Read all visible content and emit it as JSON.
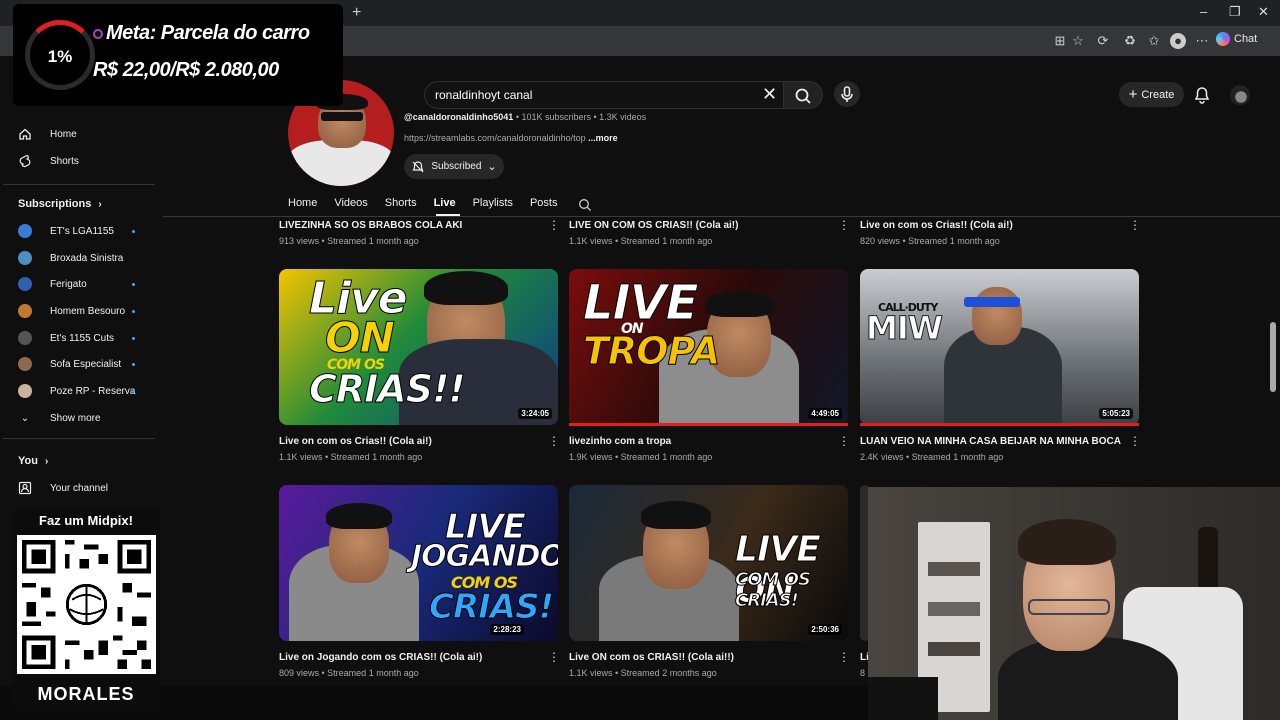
{
  "browser": {
    "new_tab": "+",
    "chat_label": "Chat",
    "window_controls": [
      "–",
      "❐",
      "✕"
    ]
  },
  "header": {
    "search_value": "ronaldinhoyt canal",
    "create_label": "Create"
  },
  "sidebar": {
    "home": "Home",
    "shorts": "Shorts",
    "subscriptions_heading": "Subscriptions",
    "subscriptions": [
      {
        "name": "ET's LGA1155",
        "color": "#3a7bd5",
        "new": true
      },
      {
        "name": "Broxada Sinistra",
        "color": "#4a90c0",
        "new": false
      },
      {
        "name": "Ferigato",
        "color": "#2f5fb0",
        "new": true
      },
      {
        "name": "Homem Besouro",
        "color": "#c07a30",
        "new": true
      },
      {
        "name": "Et's 1155 Cuts",
        "color": "#555555",
        "new": true
      },
      {
        "name": "Sofa Especialist",
        "color": "#8a6a50",
        "new": true
      },
      {
        "name": "Poze RP - Reserva",
        "color": "#c9b39a",
        "new": true
      }
    ],
    "show_more": "Show more",
    "you_heading": "You",
    "your_channel": "Your channel"
  },
  "channel": {
    "handle": "@canaldoronaldinho5041",
    "stats": " • 101K subscribers • 1.3K videos",
    "link": "https://streamlabs.com/canaldoronaldinho/top",
    "more": "...more",
    "subscribed_label": "Subscribed",
    "tabs": [
      "Home",
      "Videos",
      "Shorts",
      "Live",
      "Playlists",
      "Posts"
    ],
    "active_tab": "Live"
  },
  "videos_top": [
    {
      "title": "LIVEZINHA SO OS BRABOS COLA AKI",
      "meta": "913 views • Streamed 1 month ago"
    },
    {
      "title": "LIVE ON COM OS CRIAS!! (Cola ai!)",
      "meta": "1.1K views • Streamed 1 month ago"
    },
    {
      "title": "Live on com os Crias!! (Cola ai!)",
      "meta": "820 views • Streamed 1 month ago"
    }
  ],
  "videos_mid": [
    {
      "title": "Live on com os Crias!! (Cola ai!)",
      "meta": "1.1K views • Streamed 1 month ago",
      "duration": "3:24:05",
      "thumb_text": [
        "Live",
        "ON",
        "COM OS",
        "CRIAS!!"
      ]
    },
    {
      "title": "livezinho com a tropa",
      "meta": "1.9K views • Streamed 1 month ago",
      "duration": "4:49:05",
      "thumb_text": [
        "LIVE",
        "ON",
        "TROPA"
      ]
    },
    {
      "title": "LUAN VEIO NA MINHA CASA BEIJAR NA MINHA BOCA",
      "meta": "2.4K views • Streamed 1 month ago",
      "duration": "5:05:23",
      "thumb_text": [
        "CALL·DUTY",
        "MIW"
      ]
    }
  ],
  "videos_bottom": [
    {
      "title": "Live on Jogando com os CRIAS!! (Cola ai!)",
      "meta": "809 views • Streamed 1 month ago",
      "duration": "2:28:23",
      "thumb_text": [
        "LIVE",
        "JOGANDO",
        "COM OS",
        "CRIAS!"
      ]
    },
    {
      "title": "Live ON com os CRIAS!! (Cola ai!!)",
      "meta": "1.1K views • Streamed 2 months ago",
      "duration": "2:50:36",
      "thumb_text": [
        "LIVE ON",
        "COM OS CRIAS!"
      ]
    },
    {
      "title": "Li",
      "meta": "8",
      "duration": "",
      "thumb_text": []
    }
  ],
  "overlay": {
    "goal_percent": "1%",
    "goal_title": "Meta: Parcela do carro",
    "goal_amount": "R$ 22,00/R$ 2.080,00",
    "pix_title": "Faz um Midpix!",
    "streamer_name": "MORALES"
  }
}
